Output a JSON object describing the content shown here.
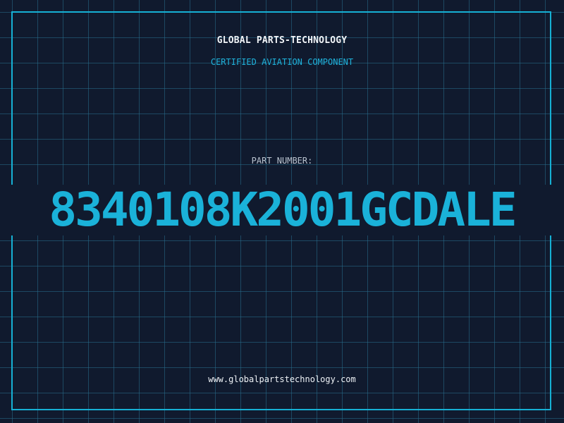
{
  "header": {
    "company": "GLOBAL PARTS-TECHNOLOGY",
    "tagline": "CERTIFIED AVIATION COMPONENT"
  },
  "part": {
    "label": "PART NUMBER:",
    "number": "8340108K2001GCDALE"
  },
  "footer": {
    "website": "www.globalpartstechnology.com"
  },
  "colors": {
    "background": "#101a2e",
    "grid": "#286e8c",
    "accent": "#1ab2d9",
    "text": "#f2f5f8",
    "muted": "#b9c3cf"
  }
}
